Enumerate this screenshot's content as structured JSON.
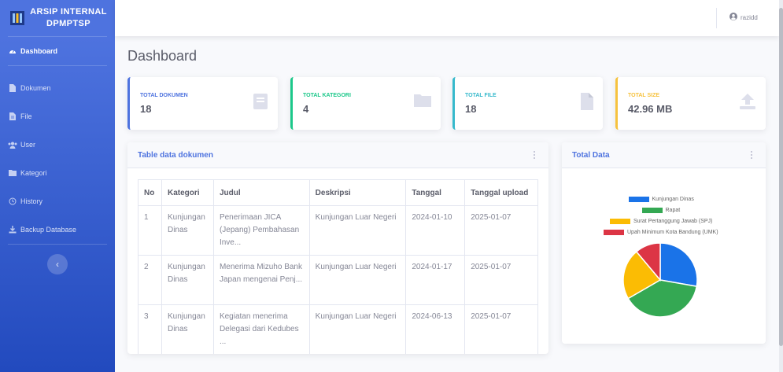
{
  "brand": {
    "title": "ARSIP INTERNAL DPMPTSP"
  },
  "sidebar": {
    "items": [
      {
        "label": "Dashboard",
        "icon": "tachometer-icon"
      },
      {
        "label": "Dokumen",
        "icon": "file-icon"
      },
      {
        "label": "File",
        "icon": "file-alt-icon"
      },
      {
        "label": "User",
        "icon": "users-icon"
      },
      {
        "label": "Kategori",
        "icon": "folder-icon"
      },
      {
        "label": "History",
        "icon": "history-icon"
      },
      {
        "label": "Backup Database",
        "icon": "download-icon"
      }
    ],
    "toggle": "‹"
  },
  "topbar": {
    "username": "razidd"
  },
  "page": {
    "title": "Dashboard"
  },
  "stats": [
    {
      "label": "TOTAL DOKUMEN",
      "value": "18",
      "color": "#4e73df",
      "icon": "book-icon"
    },
    {
      "label": "TOTAL KATEGORI",
      "value": "4",
      "color": "#1cc88a",
      "icon": "folder-icon"
    },
    {
      "label": "TOTAL FILE",
      "value": "18",
      "color": "#36b9cc",
      "icon": "file-icon"
    },
    {
      "label": "TOTAL SIZE",
      "value": "42.96 MB",
      "color": "#f6c23e",
      "icon": "upload-icon"
    }
  ],
  "table_card": {
    "title": "Table data dokumen",
    "columns": [
      "No",
      "Kategori",
      "Judul",
      "Deskripsi",
      "Tanggal",
      "Tanggal upload"
    ],
    "rows": [
      [
        "1",
        "Kunjungan Dinas",
        "Penerimaan JICA (Jepang) Pembahasan Inve...",
        "Kunjungan Luar Negeri",
        "2024-01-10",
        "2025-01-07"
      ],
      [
        "2",
        "Kunjungan Dinas",
        "Menerima Mizuho Bank Japan mengenai Penj...",
        "Kunjungan Luar Negeri",
        "2024-01-17",
        "2025-01-07"
      ],
      [
        "3",
        "Kunjungan Dinas",
        "Kegiatan menerima Delegasi dari Kedubes ...",
        "Kunjungan Luar Negeri",
        "2024-06-13",
        "2025-01-07"
      ]
    ]
  },
  "chart_card": {
    "title": "Total Data"
  },
  "chart_data": {
    "type": "pie",
    "legend_position": "top",
    "series": [
      {
        "name": "Kunjungan Dinas",
        "value": 5,
        "color": "#1a73e8"
      },
      {
        "name": "Rapat",
        "value": 7,
        "color": "#34a853"
      },
      {
        "name": "Surat Pertanggung Jawab (SPJ)",
        "value": 4,
        "color": "#fbbc04"
      },
      {
        "name": "Upah Minimum Kota Bandung (UMK)",
        "value": 2,
        "color": "#dc3545"
      }
    ]
  }
}
